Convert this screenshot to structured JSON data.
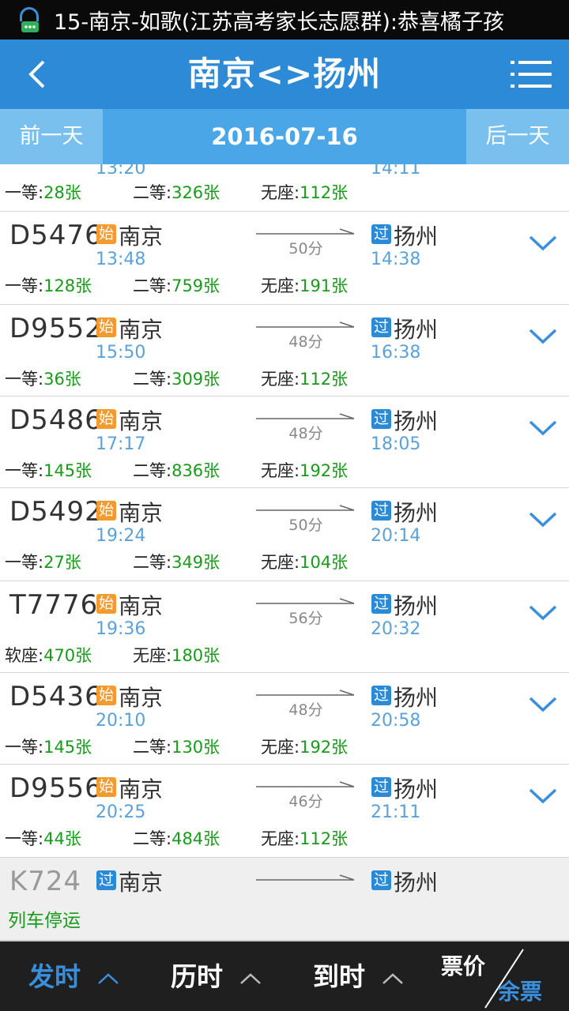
{
  "notification": {
    "text": "15-南京-如歌(江苏高考家长志愿群):恭喜橘子孩"
  },
  "header": {
    "title": "南京<>扬州"
  },
  "datebar": {
    "prev_label": "前一天",
    "date": "2016-07-16",
    "next_label": "后一天"
  },
  "partial_row": {
    "depart_time": "13:20",
    "arrive_time": "14:11",
    "seats": [
      {
        "label": "一等:",
        "value": "28张"
      },
      {
        "label": "二等:",
        "value": "326张"
      },
      {
        "label": "无座:",
        "value": "112张"
      }
    ]
  },
  "trains": [
    {
      "train_no": "D5476",
      "origin_badge": "始",
      "from": "南京",
      "depart": "13:48",
      "duration": "50分",
      "dest_badge": "过",
      "to": "扬州",
      "arrive": "14:38",
      "seats": [
        {
          "label": "一等:",
          "value": "128张"
        },
        {
          "label": "二等:",
          "value": "759张"
        },
        {
          "label": "无座:",
          "value": "191张"
        }
      ]
    },
    {
      "train_no": "D9552",
      "origin_badge": "始",
      "from": "南京",
      "depart": "15:50",
      "duration": "48分",
      "dest_badge": "过",
      "to": "扬州",
      "arrive": "16:38",
      "seats": [
        {
          "label": "一等:",
          "value": "36张"
        },
        {
          "label": "二等:",
          "value": "309张"
        },
        {
          "label": "无座:",
          "value": "112张"
        }
      ]
    },
    {
      "train_no": "D5486",
      "origin_badge": "始",
      "from": "南京",
      "depart": "17:17",
      "duration": "48分",
      "dest_badge": "过",
      "to": "扬州",
      "arrive": "18:05",
      "seats": [
        {
          "label": "一等:",
          "value": "145张"
        },
        {
          "label": "二等:",
          "value": "836张"
        },
        {
          "label": "无座:",
          "value": "192张"
        }
      ]
    },
    {
      "train_no": "D5492",
      "origin_badge": "始",
      "from": "南京",
      "depart": "19:24",
      "duration": "50分",
      "dest_badge": "过",
      "to": "扬州",
      "arrive": "20:14",
      "seats": [
        {
          "label": "一等:",
          "value": "27张"
        },
        {
          "label": "二等:",
          "value": "349张"
        },
        {
          "label": "无座:",
          "value": "104张"
        }
      ]
    },
    {
      "train_no": "T7776",
      "origin_badge": "始",
      "from": "南京",
      "depart": "19:36",
      "duration": "56分",
      "dest_badge": "过",
      "to": "扬州",
      "arrive": "20:32",
      "seats": [
        {
          "label": "软座:",
          "value": "470张"
        },
        {
          "label": "无座:",
          "value": "180张"
        }
      ]
    },
    {
      "train_no": "D5436",
      "origin_badge": "始",
      "from": "南京",
      "depart": "20:10",
      "duration": "48分",
      "dest_badge": "过",
      "to": "扬州",
      "arrive": "20:58",
      "seats": [
        {
          "label": "一等:",
          "value": "145张"
        },
        {
          "label": "二等:",
          "value": "130张"
        },
        {
          "label": "无座:",
          "value": "192张"
        }
      ]
    },
    {
      "train_no": "D9556",
      "origin_badge": "始",
      "from": "南京",
      "depart": "20:25",
      "duration": "46分",
      "dest_badge": "过",
      "to": "扬州",
      "arrive": "21:11",
      "seats": [
        {
          "label": "一等:",
          "value": "44张"
        },
        {
          "label": "二等:",
          "value": "484张"
        },
        {
          "label": "无座:",
          "value": "112张"
        }
      ]
    }
  ],
  "suspended_train": {
    "train_no": "K724",
    "origin_badge": "过",
    "from": "南京",
    "dest_badge": "过",
    "to": "扬州",
    "status": "列车停运"
  },
  "bottombar": {
    "depart_sort": "发时",
    "duration_sort": "历时",
    "arrive_sort": "到时",
    "price_label": "票价",
    "remain_label": "余票"
  },
  "colors": {
    "header_blue": "#2c8ad6",
    "datebar_blue": "#4aa6e6",
    "time_blue": "#5ca1d8",
    "seat_green": "#1a9a1a",
    "origin_badge_orange": "#f39b2f",
    "active_sort_blue": "#3a8fdc"
  }
}
